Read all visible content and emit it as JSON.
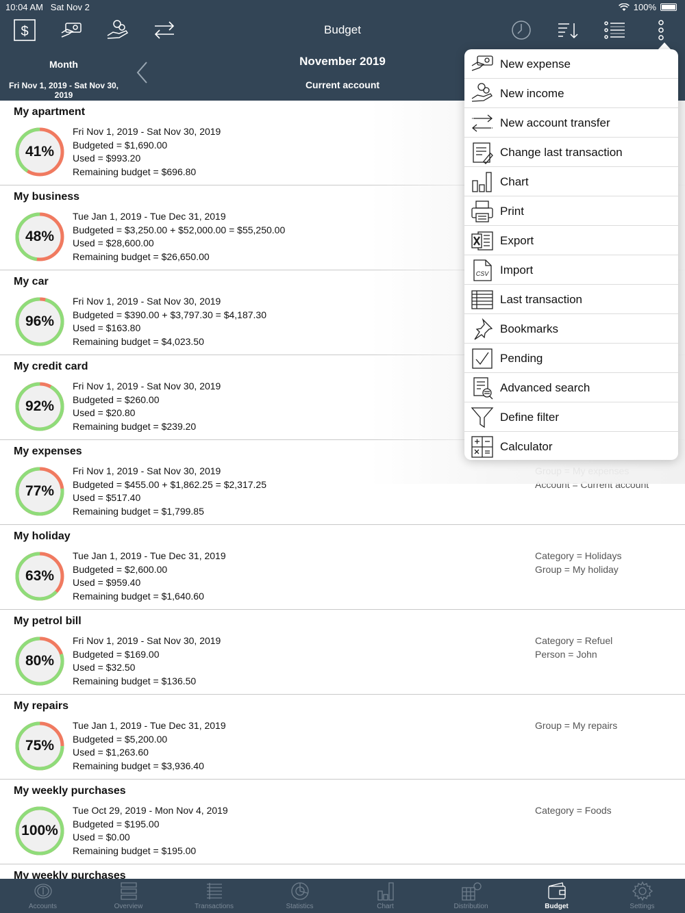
{
  "status_bar": {
    "time": "10:04 AM",
    "date": "Sat Nov 2",
    "battery": "100%"
  },
  "header": {
    "title": "Budget",
    "period_label": "Month",
    "period_range": "Fri Nov 1, 2019 - Sat Nov 30, 2019",
    "month_title": "November 2019",
    "account": "Current account",
    "left_icons": [
      "dollar-icon",
      "new-expense-icon",
      "new-income-icon",
      "transfer-icon"
    ],
    "right_icons": [
      "clock-icon",
      "sort-icon",
      "list-icon",
      "more-icon"
    ]
  },
  "budgets": [
    {
      "name": "My apartment",
      "percent": "41%",
      "ratio": 0.41,
      "period": "Fri Nov 1, 2019 - Sat Nov 30, 2019",
      "budgeted": "Budgeted = $1,690.00",
      "used": "Used = $993.20",
      "remaining": "Remaining budget = $696.80",
      "filters": []
    },
    {
      "name": "My business",
      "percent": "48%",
      "ratio": 0.48,
      "period": "Tue Jan 1, 2019 - Tue Dec 31, 2019",
      "budgeted": "Budgeted = $3,250.00 + $52,000.00 = $55,250.00",
      "used": "Used = $28,600.00",
      "remaining": "Remaining budget = $26,650.00",
      "filters": []
    },
    {
      "name": "My car",
      "percent": "96%",
      "ratio": 0.96,
      "period": "Fri Nov 1, 2019 - Sat Nov 30, 2019",
      "budgeted": "Budgeted = $390.00 + $3,797.30 = $4,187.30",
      "used": "Used = $163.80",
      "remaining": "Remaining budget = $4,023.50",
      "filters": []
    },
    {
      "name": "My credit card",
      "percent": "92%",
      "ratio": 0.92,
      "period": "Fri Nov 1, 2019 - Sat Nov 30, 2019",
      "budgeted": "Budgeted = $260.00",
      "used": "Used = $20.80",
      "remaining": "Remaining budget = $239.20",
      "filters": []
    },
    {
      "name": "My expenses",
      "percent": "77%",
      "ratio": 0.77,
      "period": "Fri Nov 1, 2019 - Sat Nov 30, 2019",
      "budgeted": "Budgeted = $455.00 + $1,862.25 = $2,317.25",
      "used": "Used = $517.40",
      "remaining": "Remaining budget = $1,799.85",
      "filters": [
        "Group = My expenses",
        "Account = Current account"
      ]
    },
    {
      "name": "My holiday",
      "percent": "63%",
      "ratio": 0.63,
      "period": "Tue Jan 1, 2019 - Tue Dec 31, 2019",
      "budgeted": "Budgeted = $2,600.00",
      "used": "Used = $959.40",
      "remaining": "Remaining budget = $1,640.60",
      "filters": [
        "Category = Holidays",
        "Group = My holiday"
      ]
    },
    {
      "name": "My petrol bill",
      "percent": "80%",
      "ratio": 0.8,
      "period": "Fri Nov 1, 2019 - Sat Nov 30, 2019",
      "budgeted": "Budgeted = $169.00",
      "used": "Used = $32.50",
      "remaining": "Remaining budget = $136.50",
      "filters": [
        "Category = Refuel",
        "Person = John"
      ]
    },
    {
      "name": "My repairs",
      "percent": "75%",
      "ratio": 0.75,
      "period": "Tue Jan 1, 2019 - Tue Dec 31, 2019",
      "budgeted": "Budgeted = $5,200.00",
      "used": "Used = $1,263.60",
      "remaining": "Remaining budget = $3,936.40",
      "filters": [
        "Group = My repairs"
      ]
    },
    {
      "name": "My weekly purchases",
      "percent": "100%",
      "ratio": 1.0,
      "period": "Tue Oct 29, 2019 - Mon Nov 4, 2019",
      "budgeted": "Budgeted = $195.00",
      "used": "Used = $0.00",
      "remaining": "Remaining budget = $195.00",
      "filters": [
        "Category = Foods"
      ]
    },
    {
      "name": "My weekly purchases",
      "percent": "",
      "ratio": 1.0,
      "period": "",
      "budgeted": "",
      "used": "",
      "remaining": "",
      "filters": []
    }
  ],
  "menu": [
    {
      "label": "New expense",
      "icon": "new-expense-icon"
    },
    {
      "label": "New income",
      "icon": "new-income-icon"
    },
    {
      "label": "New account transfer",
      "icon": "transfer-icon"
    },
    {
      "label": "Change last transaction",
      "icon": "edit-document-icon"
    },
    {
      "label": "Chart",
      "icon": "bar-chart-icon"
    },
    {
      "label": "Print",
      "icon": "printer-icon"
    },
    {
      "label": "Export",
      "icon": "excel-icon"
    },
    {
      "label": "Import",
      "icon": "csv-file-icon"
    },
    {
      "label": "Last transaction",
      "icon": "table-icon"
    },
    {
      "label": "Bookmarks",
      "icon": "pin-icon"
    },
    {
      "label": "Pending",
      "icon": "checkbox-icon"
    },
    {
      "label": "Advanced search",
      "icon": "search-document-icon"
    },
    {
      "label": "Define filter",
      "icon": "funnel-icon"
    },
    {
      "label": "Calculator",
      "icon": "calculator-icon"
    }
  ],
  "tabs": [
    {
      "label": "Accounts",
      "icon": "coins-icon",
      "active": false
    },
    {
      "label": "Overview",
      "icon": "overview-icon",
      "active": false
    },
    {
      "label": "Transactions",
      "icon": "transactions-icon",
      "active": false
    },
    {
      "label": "Statistics",
      "icon": "pie-icon",
      "active": false
    },
    {
      "label": "Chart",
      "icon": "bar-chart-icon",
      "active": false
    },
    {
      "label": "Distribution",
      "icon": "distribution-icon",
      "active": false
    },
    {
      "label": "Budget",
      "icon": "wallet-icon",
      "active": true
    },
    {
      "label": "Settings",
      "icon": "gear-icon",
      "active": false
    }
  ],
  "colors": {
    "header_bg": "#334556",
    "ring_green": "#8fdc7a",
    "ring_red": "#f07a60",
    "ring_bg": "#f0f0f0"
  }
}
